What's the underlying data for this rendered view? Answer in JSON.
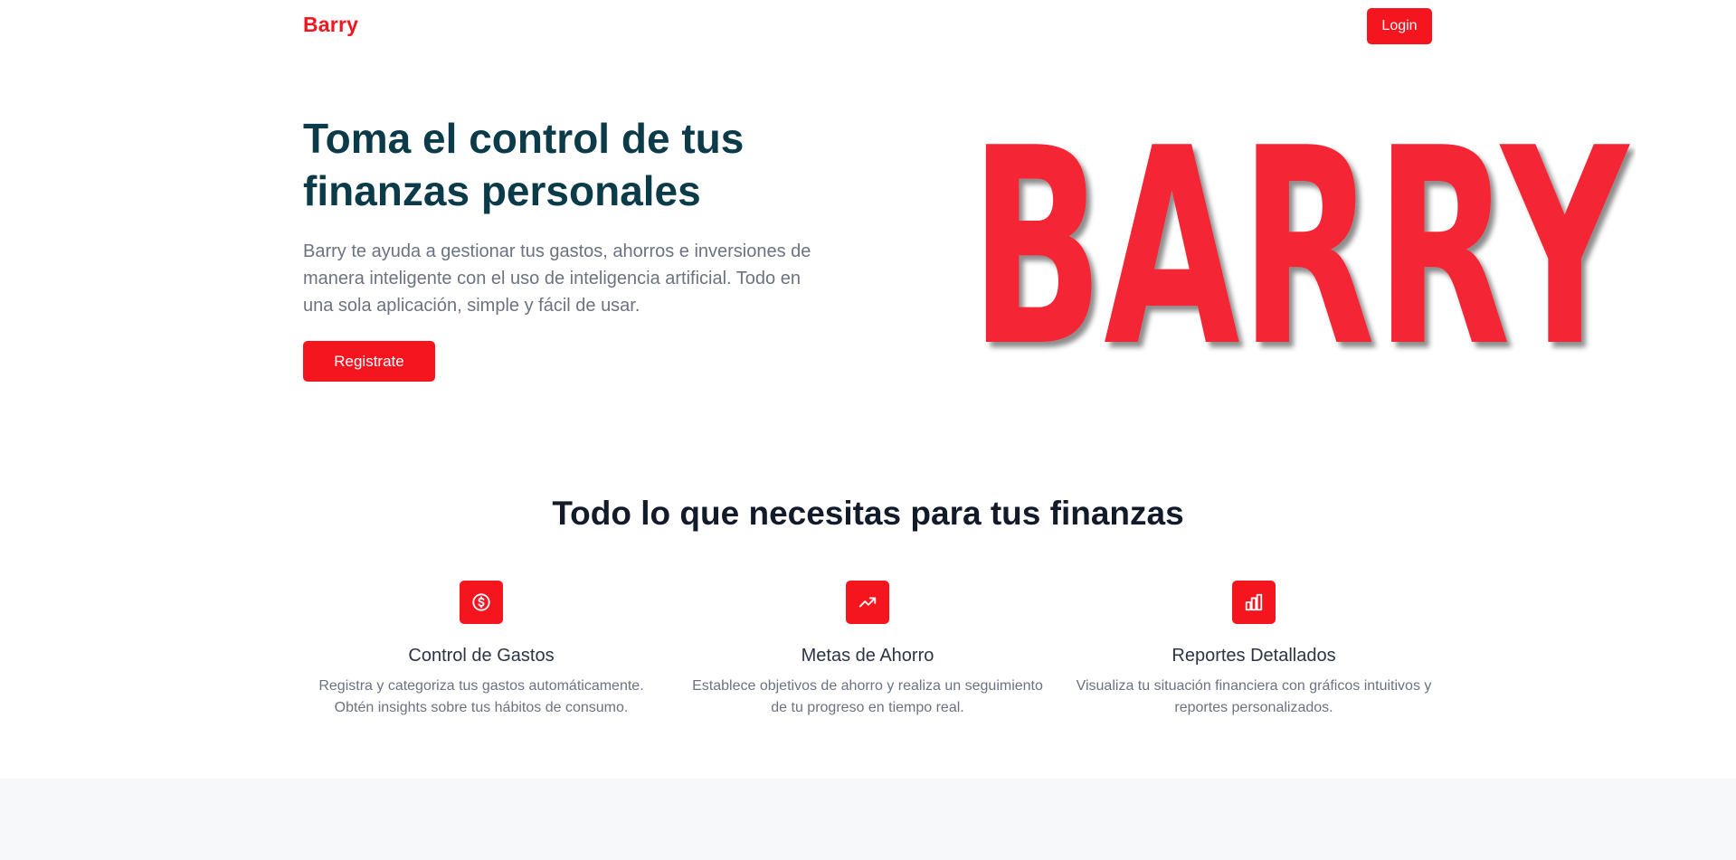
{
  "header": {
    "brand": "Barry",
    "login_label": "Login"
  },
  "hero": {
    "title": "Toma el control de tus finanzas personales",
    "description": "Barry te ayuda a gestionar tus gastos, ahorros e inversiones de manera inteligente con el uso de inteligencia artificial. Todo en una sola aplicación, simple y fácil de usar.",
    "cta_label": "Registrate",
    "logo_text": "BARRY"
  },
  "features": {
    "title": "Todo lo que necesitas para tus finanzas",
    "items": [
      {
        "icon": "dollar-circle-icon",
        "title": "Control de Gastos",
        "description": "Registra y categoriza tus gastos automáticamente. Obtén insights sobre tus hábitos de consumo."
      },
      {
        "icon": "trending-up-icon",
        "title": "Metas de Ahorro",
        "description": "Establece objetivos de ahorro y realiza un seguimiento de tu progreso en tiempo real."
      },
      {
        "icon": "bar-chart-icon",
        "title": "Reportes Detallados",
        "description": "Visualiza tu situación financiera con gráficos intuitivos y reportes personalizados."
      }
    ]
  },
  "colors": {
    "brand_red": "#f5151f",
    "logo_red": "#f42834",
    "heading_dark_teal": "#0b3a48",
    "text_gray": "#6b7280",
    "band_gray": "#f7f8fa"
  }
}
